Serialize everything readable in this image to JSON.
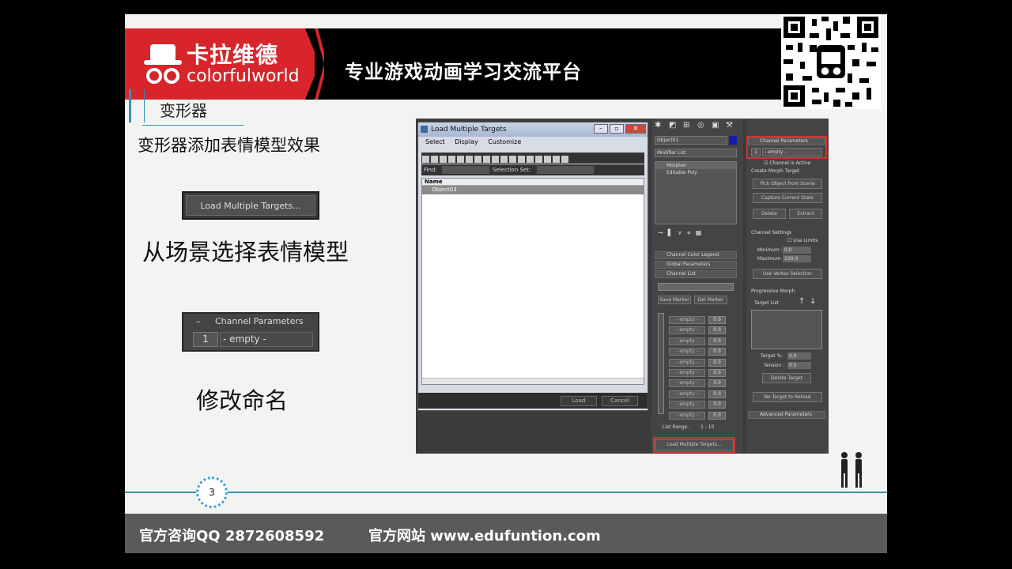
{
  "header": {
    "logo_cn": "卡拉维德",
    "logo_en": "colorfulworld",
    "tagline": "专业游戏动画学习交流平台"
  },
  "section": {
    "title": "变形器",
    "subtitle": "变形器添加表情模型效果"
  },
  "examples": {
    "load_button": "Load Multiple Targets...",
    "caption1": "从场景选择表情模型",
    "channel_title": "Channel Parameters",
    "channel_num": "1",
    "channel_empty": "- empty -",
    "caption2": "修改命名"
  },
  "dialog": {
    "title": "Load Multiple Targets",
    "menu": [
      "Select",
      "Display",
      "Customize"
    ],
    "find_label": "Find:",
    "selection_set": "Selection Set:",
    "column": "Name",
    "items": [
      "Object03"
    ],
    "load": "Load",
    "cancel": "Cancel"
  },
  "modify": {
    "object": "Object01",
    "modifier_list": "Modifier List",
    "stack": [
      "Morpher",
      "Editable Poly"
    ],
    "rollouts": [
      "Channel Color Legend",
      "Global Parameters",
      "Channel List"
    ],
    "save_marker": "Save Marker",
    "del_marker": "Del Marker",
    "slot_label": "- empty -",
    "slot_value": "0.0",
    "list_range_label": "List Range :",
    "list_range": "1 - 10",
    "load_multi": "Load Multiple Targets..."
  },
  "channel": {
    "title": "Channel Parameters",
    "num": "1",
    "empty": "- empty -",
    "active": "Channel is Active",
    "create": "Create Morph Target",
    "pick": "Pick Object from Scene",
    "capture": "Capture Current State",
    "delete": "Delete",
    "extract": "Extract",
    "settings": "Channel Settings",
    "use_limits": "Use Limits",
    "minimum": "Minimum :",
    "minimum_val": "0.0",
    "maximum": "Maximum :",
    "maximum_val": "100.0",
    "vertex_sel": "Use Vertex Selection",
    "progressive": "Progressive Morph",
    "target_list": "Target List",
    "target_pct": "Target %:",
    "target_pct_val": "0.0",
    "tension": "Tension :",
    "tension_val": "0.5",
    "delete_target": "Delete Target",
    "reload": "No Target to Reload",
    "advanced": "Advanced Parameters"
  },
  "footer": {
    "page": "3",
    "qq": "官方咨询QQ 2872608592",
    "website": "官方网站 www.edufuntion.com"
  }
}
